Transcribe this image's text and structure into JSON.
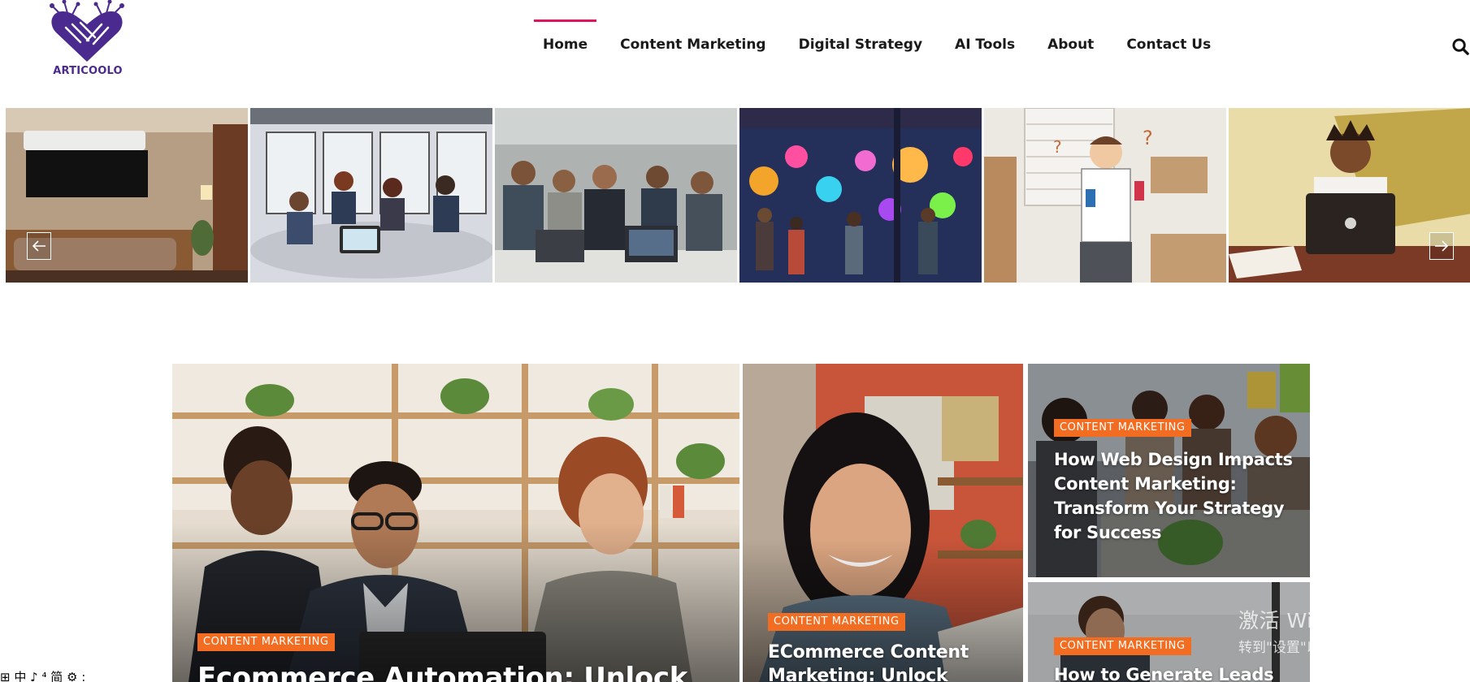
{
  "brand": {
    "name": "ARTICOOLO",
    "accent_color": "#e0135d",
    "logo_color": "#4b2a8f"
  },
  "nav": {
    "items": [
      {
        "label": "Home",
        "active": true
      },
      {
        "label": "Content Marketing",
        "active": false
      },
      {
        "label": "Digital Strategy",
        "active": false
      },
      {
        "label": "AI Tools",
        "active": false
      },
      {
        "label": "About",
        "active": false
      },
      {
        "label": "Contact Us",
        "active": false
      }
    ],
    "search_icon": "search-icon"
  },
  "carousel": {
    "prev_icon": "arrow-left-icon",
    "next_icon": "arrow-right-icon",
    "slides": [
      "living-room-air-conditioner",
      "illustrated-office-meeting",
      "team-around-laptop",
      "neon-art-gallery-crowd",
      "confused-man-with-phones",
      "person-at-laptop-illustration"
    ]
  },
  "featured": {
    "badge_color": "#f26d21",
    "cards": [
      {
        "category": "CONTENT MARKETING",
        "title": "Ecommerce Automation: Unlock"
      },
      {
        "category": "CONTENT MARKETING",
        "title_line1": "ECommerce Content",
        "title_line2": "Marketing: Unlock"
      },
      {
        "category": "CONTENT MARKETING",
        "title_line1": "How Web Design Impacts",
        "title_line2": "Content Marketing:",
        "title_line3": "Transform Your Strategy",
        "title_line4": "for Success"
      },
      {
        "category": "CONTENT MARKETING",
        "title": "How to Generate Leads"
      }
    ]
  },
  "overlays": {
    "windows_activation_line1": "激活 Windows",
    "windows_activation_line2": "转到\"设置\"以激活 Windows。",
    "ime_toolbar": "⊞ 中 ♪ ⁴ 简 ⚙ :"
  }
}
